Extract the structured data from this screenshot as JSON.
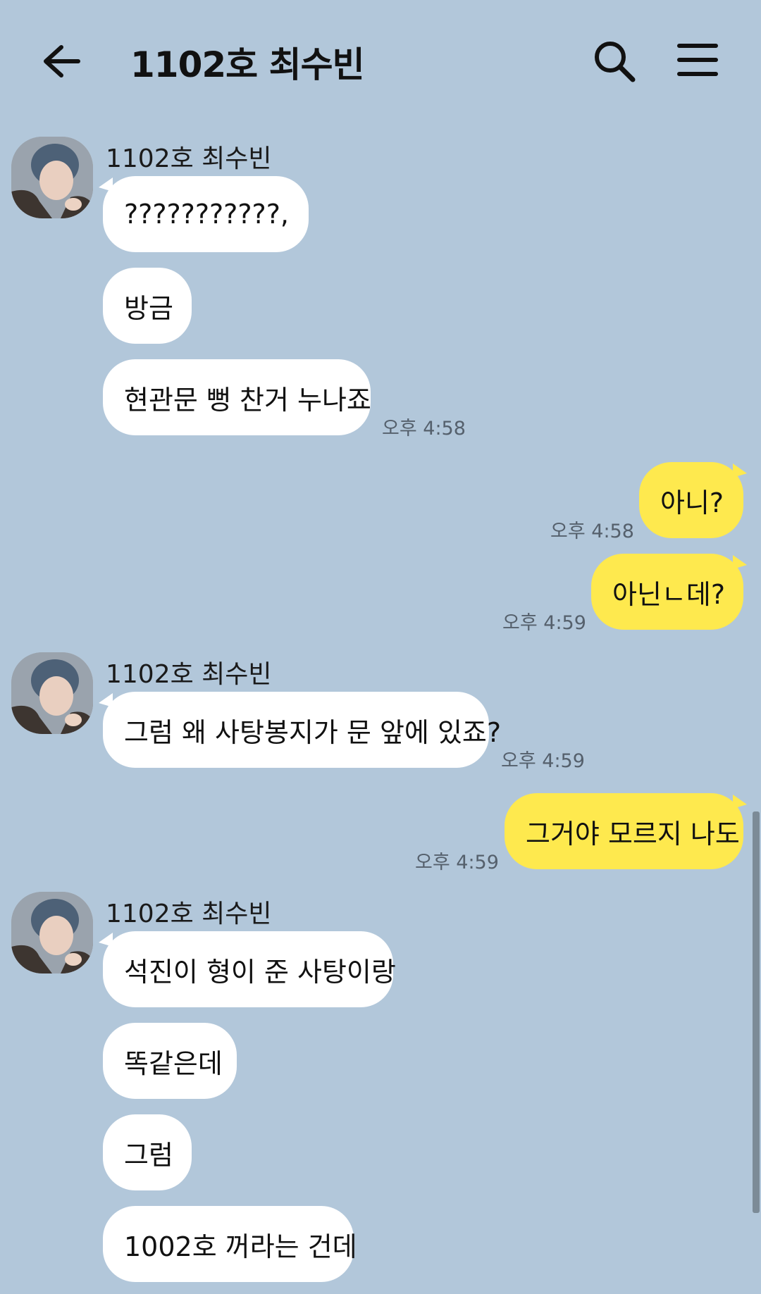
{
  "header": {
    "title": "1102호 최수빈",
    "back_icon": "arrow-left-icon",
    "search_icon": "search-icon",
    "menu_icon": "hamburger-menu-icon"
  },
  "colors": {
    "background": "#b2c7da",
    "incoming_bubble": "#ffffff",
    "outgoing_bubble": "#fee94e"
  },
  "groups": [
    {
      "sender": "1102호 최수빈",
      "messages": [
        "???????????,",
        "방금",
        "현관문 뻥 찬거 누나죠"
      ],
      "time": "오후 4:58"
    },
    {
      "sender": "me",
      "messages": [
        "아니?"
      ],
      "time": "오후 4:58"
    },
    {
      "sender": "me",
      "messages": [
        "아닌ㄴ데?"
      ],
      "time": "오후 4:59"
    },
    {
      "sender": "1102호 최수빈",
      "messages": [
        "그럼 왜 사탕봉지가 문 앞에 있죠?"
      ],
      "time": "오후 4:59"
    },
    {
      "sender": "me",
      "messages": [
        "그거야 모르지 나도"
      ],
      "time": "오후 4:59"
    },
    {
      "sender": "1102호 최수빈",
      "messages": [
        "석진이 형이 준 사탕이랑",
        "똑같은데",
        "그럼",
        "1002호 꺼라는 건데"
      ],
      "time": ""
    }
  ]
}
